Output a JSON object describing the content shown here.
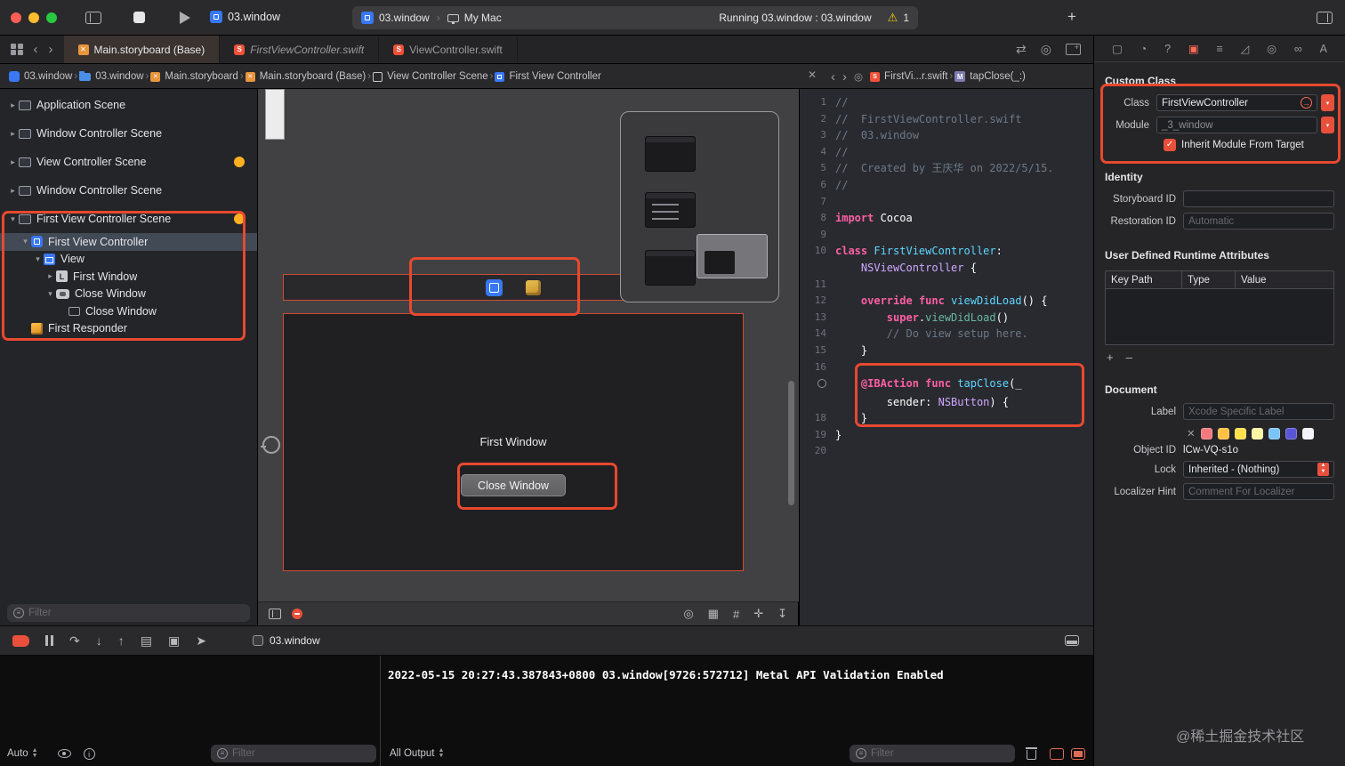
{
  "toolbar": {
    "title": "03.window",
    "scheme_pill": {
      "target": "03.window",
      "device": "My Mac",
      "status": "Running 03.window : 03.window",
      "warning_count": "1"
    }
  },
  "tabbar": {
    "tabs": [
      {
        "label": "Main.storyboard (Base)"
      },
      {
        "label": "FirstViewController.swift"
      },
      {
        "label": "ViewController.swift"
      }
    ]
  },
  "jumpbar": {
    "left": [
      {
        "label": "03.window",
        "icon": "app"
      },
      {
        "label": "03.window",
        "icon": "folder"
      },
      {
        "label": "Main.storyboard",
        "icon": "storyboard"
      },
      {
        "label": "Main.storyboard (Base)",
        "icon": "storyboard"
      },
      {
        "label": "View Controller Scene",
        "icon": "scene"
      },
      {
        "label": "First View Controller",
        "icon": "vc"
      }
    ],
    "right": [
      {
        "label": "FirstVi...r.swift",
        "icon": "swift"
      },
      {
        "label": "tapClose(_:)",
        "icon": "method"
      }
    ]
  },
  "outline": {
    "items": [
      {
        "label": "Application Scene",
        "level": 0,
        "icon": "scene",
        "disclosure": "collapsed"
      },
      {
        "label": "Window Controller Scene",
        "level": 0,
        "icon": "scene",
        "disclosure": "collapsed"
      },
      {
        "label": "View Controller Scene",
        "level": 0,
        "icon": "scene",
        "disclosure": "collapsed",
        "warning": true
      },
      {
        "label": "Window Controller Scene",
        "level": 0,
        "icon": "scene",
        "disclosure": "collapsed"
      },
      {
        "label": "First View Controller Scene",
        "level": 0,
        "icon": "scene",
        "disclosure": "expanded",
        "warning": true
      },
      {
        "label": "First View Controller",
        "level": 1,
        "icon": "vc",
        "disclosure": "expanded",
        "selected": true
      },
      {
        "label": "View",
        "level": 2,
        "icon": "view",
        "disclosure": "expanded"
      },
      {
        "label": "First Window",
        "level": 3,
        "icon": "label",
        "disclosure": "collapsed"
      },
      {
        "label": "Close Window",
        "level": 3,
        "icon": "button",
        "disclosure": "expanded"
      },
      {
        "label": "Close Window",
        "level": 4,
        "icon": "cell",
        "disclosure": "none"
      },
      {
        "label": "First Responder",
        "level": 1,
        "icon": "responder",
        "disclosure": "none"
      }
    ],
    "filter_placeholder": "Filter"
  },
  "canvas": {
    "first_window_label": "First Window",
    "close_button_label": "Close Window"
  },
  "code": {
    "rows": [
      {
        "n": "1",
        "toks": [
          [
            "c",
            "//"
          ]
        ]
      },
      {
        "n": "2",
        "toks": [
          [
            "c",
            "//  FirstViewController.swift"
          ]
        ]
      },
      {
        "n": "3",
        "toks": [
          [
            "c",
            "//  03.window"
          ]
        ]
      },
      {
        "n": "4",
        "toks": [
          [
            "c",
            "//"
          ]
        ]
      },
      {
        "n": "5",
        "toks": [
          [
            "c",
            "//  Created by 王庆华 on 2022/5/15."
          ]
        ]
      },
      {
        "n": "6",
        "toks": [
          [
            "c",
            "//"
          ]
        ]
      },
      {
        "n": "7",
        "toks": []
      },
      {
        "n": "8",
        "toks": [
          [
            "k",
            "import"
          ],
          [
            "p",
            " Cocoa"
          ]
        ]
      },
      {
        "n": "9",
        "toks": []
      },
      {
        "n": "10",
        "toks": [
          [
            "k",
            "class"
          ],
          [
            "p",
            " "
          ],
          [
            "d",
            "FirstViewController"
          ],
          [
            "p",
            ":"
          ]
        ]
      },
      {
        "n": "",
        "toks": [
          [
            "p",
            "    "
          ],
          [
            "t",
            "NSViewController"
          ],
          [
            "p",
            " {"
          ]
        ]
      },
      {
        "n": "11",
        "toks": []
      },
      {
        "n": "12",
        "toks": [
          [
            "p",
            "    "
          ],
          [
            "k",
            "override"
          ],
          [
            "p",
            " "
          ],
          [
            "k",
            "func"
          ],
          [
            "p",
            " "
          ],
          [
            "d",
            "viewDidLoad"
          ],
          [
            "p",
            "() {"
          ]
        ]
      },
      {
        "n": "13",
        "toks": [
          [
            "p",
            "        "
          ],
          [
            "k",
            "super"
          ],
          [
            "p",
            "."
          ],
          [
            "f",
            "viewDidLoad"
          ],
          [
            "p",
            "()"
          ]
        ]
      },
      {
        "n": "14",
        "toks": [
          [
            "p",
            "        "
          ],
          [
            "c",
            "// Do view setup here."
          ]
        ]
      },
      {
        "n": "15",
        "toks": [
          [
            "p",
            "    }"
          ]
        ]
      },
      {
        "n": "16",
        "toks": []
      },
      {
        "n": "dot",
        "toks": [
          [
            "p",
            "    "
          ],
          [
            "k",
            "@IBAction"
          ],
          [
            "p",
            " "
          ],
          [
            "k",
            "func"
          ],
          [
            "p",
            " "
          ],
          [
            "d",
            "tapClose"
          ],
          [
            "p",
            "(_"
          ]
        ]
      },
      {
        "n": "",
        "toks": [
          [
            "p",
            "        sender: "
          ],
          [
            "t",
            "NSButton"
          ],
          [
            "p",
            ") {"
          ]
        ]
      },
      {
        "n": "18",
        "toks": [
          [
            "p",
            "    }"
          ]
        ]
      },
      {
        "n": "19",
        "toks": [
          [
            "p",
            "}"
          ]
        ]
      },
      {
        "n": "20",
        "toks": []
      }
    ]
  },
  "debug": {
    "process": "03.window",
    "console_line": "2022-05-15 20:27:43.387843+0800 03.window[9726:572712] Metal API Validation Enabled",
    "scope": "Auto",
    "output_scope": "All Output",
    "filter_placeholder": "Filter"
  },
  "inspector": {
    "custom_class": {
      "title": "Custom Class",
      "class_label": "Class",
      "class_value": "FirstViewController",
      "module_label": "Module",
      "module_value": "_3_window",
      "inherit_label": "Inherit Module From Target"
    },
    "identity": {
      "title": "Identity",
      "storyboard_id_label": "Storyboard ID",
      "restoration_id_label": "Restoration ID",
      "restoration_id_placeholder": "Automatic"
    },
    "runtime_attrs": {
      "title": "User Defined Runtime Attributes",
      "columns": [
        "Key Path",
        "Type",
        "Value"
      ]
    },
    "document": {
      "title": "Document",
      "label_label": "Label",
      "label_placeholder": "Xcode Specific Label",
      "colors": [
        "#f2797c",
        "#ffc043",
        "#ffe14d",
        "#fdf6a3",
        "#7cc4f8",
        "#5856d6",
        "#f2f2f7"
      ],
      "object_id_label": "Object ID",
      "object_id_value": "lCw-VQ-s1o",
      "lock_label": "Lock",
      "lock_value": "Inherited - (Nothing)",
      "localizer_label": "Localizer Hint",
      "localizer_placeholder": "Comment For Localizer"
    }
  },
  "watermark": "@稀土掘金技术社区"
}
